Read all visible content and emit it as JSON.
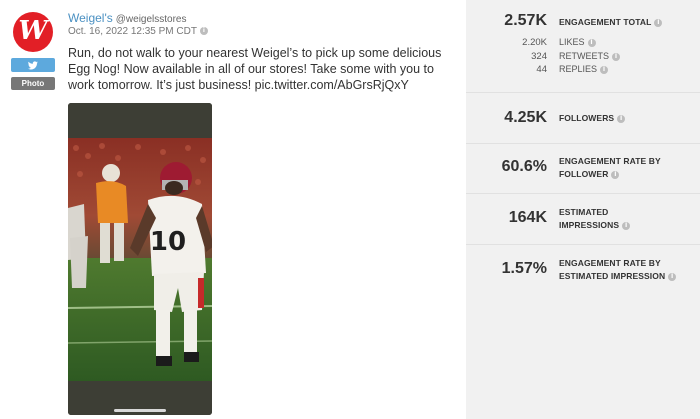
{
  "tweet": {
    "avatar_letter": "W",
    "twitter_icon": "twitter-bird-icon",
    "photo_badge": "Photo",
    "name": "Weigel's",
    "handle": "@weigelsstores",
    "date": "Oct. 16, 2022 12:35 PM CDT",
    "text": "Run, do not walk to your nearest Weigel’s to pick up some delicious Egg Nog! Now available in all of our stores! Take some with you to work tomorrow. It’s just business! pic.twitter.com/AbGrsRjQxY",
    "media_description_icon": "football-player-photo",
    "jersey_number": "10"
  },
  "stats": {
    "engagement_total_value": "2.57K",
    "engagement_total_label": "ENGAGEMENT TOTAL",
    "likes_value": "2.20K",
    "likes_label": "LIKES",
    "retweets_value": "324",
    "retweets_label": "RETWEETS",
    "replies_value": "44",
    "replies_label": "REPLIES",
    "followers_value": "4.25K",
    "followers_label": "FOLLOWERS",
    "engagement_rate_follower_value": "60.6%",
    "engagement_rate_follower_label_line1": "ENGAGEMENT RATE BY",
    "engagement_rate_follower_label_line2": "FOLLOWER",
    "estimated_impressions_value": "164K",
    "estimated_impressions_label_line1": "ESTIMATED",
    "estimated_impressions_label_line2": "IMPRESSIONS",
    "engagement_rate_impression_value": "1.57%",
    "engagement_rate_impression_label_line1": "ENGAGEMENT RATE BY",
    "engagement_rate_impression_label_line2": "ESTIMATED IMPRESSION"
  },
  "colors": {
    "brand_red": "#e21f26",
    "twitter_blue": "#5da9dd",
    "link_blue": "#4a90c2",
    "panel_gray": "#f1f1f1"
  }
}
